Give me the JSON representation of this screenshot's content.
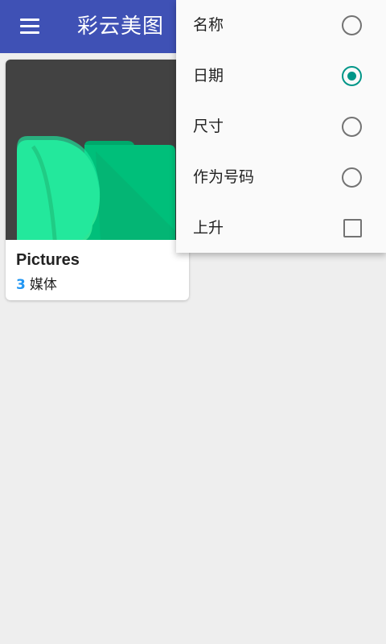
{
  "app_bar": {
    "title": "彩云美图",
    "menu_icon": "menu-icon",
    "background_color": "#3f51b5"
  },
  "album_card": {
    "name": "Pictures",
    "count": "3",
    "count_label": "媒体",
    "thumbnail_icon": "folder-feather-icon",
    "count_color": "#2196f3"
  },
  "sort_menu": {
    "items": [
      {
        "label": "名称",
        "control": "radio",
        "checked": false
      },
      {
        "label": "日期",
        "control": "radio",
        "checked": true
      },
      {
        "label": "尺寸",
        "control": "radio",
        "checked": false
      },
      {
        "label": "作为号码",
        "control": "radio",
        "checked": false
      },
      {
        "label": "上升",
        "control": "checkbox",
        "checked": false
      }
    ],
    "accent_color": "#009688"
  }
}
